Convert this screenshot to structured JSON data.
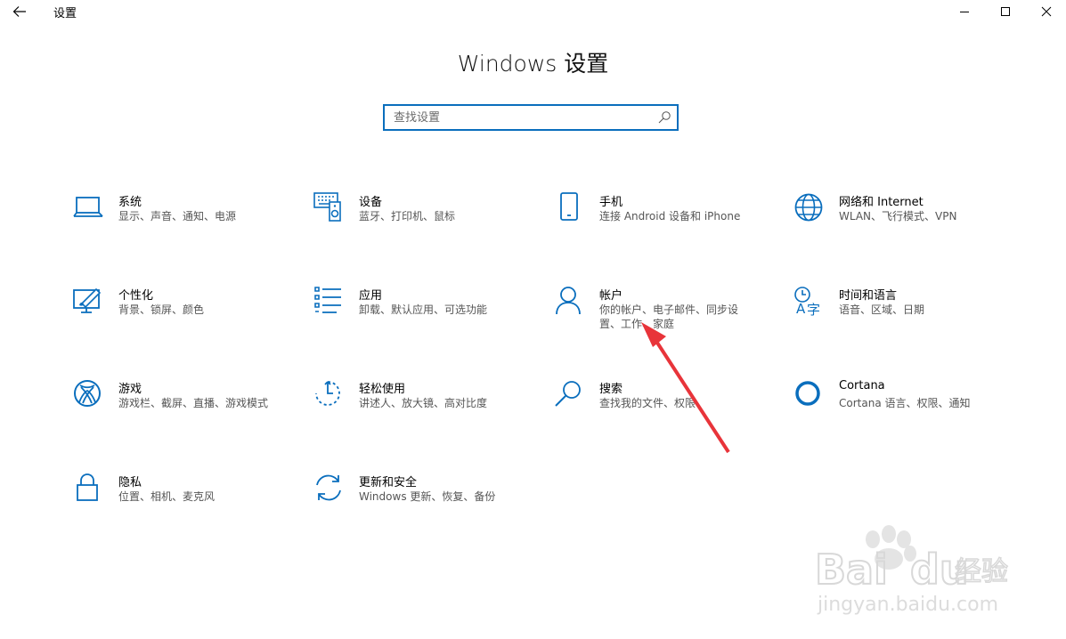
{
  "window": {
    "app_title": "设置",
    "page_title": "Windows 设置"
  },
  "search": {
    "placeholder": "查找设置",
    "value": ""
  },
  "tiles": [
    {
      "title": "系统",
      "desc": "显示、声音、通知、电源",
      "icon": "laptop-icon"
    },
    {
      "title": "设备",
      "desc": "蓝牙、打印机、鼠标",
      "icon": "devices-icon"
    },
    {
      "title": "手机",
      "desc": "连接 Android 设备和 iPhone",
      "icon": "phone-icon"
    },
    {
      "title": "网络和 Internet",
      "desc": "WLAN、飞行模式、VPN",
      "icon": "globe-icon"
    },
    {
      "title": "个性化",
      "desc": "背景、锁屏、颜色",
      "icon": "personalization-icon"
    },
    {
      "title": "应用",
      "desc": "卸载、默认应用、可选功能",
      "icon": "apps-list-icon"
    },
    {
      "title": "帐户",
      "desc": "你的帐户、电子邮件、同步设置、工作、家庭",
      "icon": "person-icon"
    },
    {
      "title": "时间和语言",
      "desc": "语音、区域、日期",
      "icon": "time-language-icon"
    },
    {
      "title": "游戏",
      "desc": "游戏栏、截屏、直播、游戏模式",
      "icon": "xbox-icon"
    },
    {
      "title": "轻松使用",
      "desc": "讲述人、放大镜、高对比度",
      "icon": "ease-of-access-icon"
    },
    {
      "title": "搜索",
      "desc": "查找我的文件、权限",
      "icon": "search-magnifier-icon"
    },
    {
      "title": "Cortana",
      "desc": "Cortana 语言、权限、通知",
      "icon": "cortana-icon"
    },
    {
      "title": "隐私",
      "desc": "位置、相机、麦克风",
      "icon": "lock-icon"
    },
    {
      "title": "更新和安全",
      "desc": "Windows 更新、恢复、备份",
      "icon": "update-icon"
    }
  ],
  "watermark": {
    "brand": "Baidu",
    "brand_cn": "经验",
    "url": "jingyan.baidu.com"
  },
  "colors": {
    "accent": "#0a6ebd",
    "arrow": "#e8343a"
  }
}
